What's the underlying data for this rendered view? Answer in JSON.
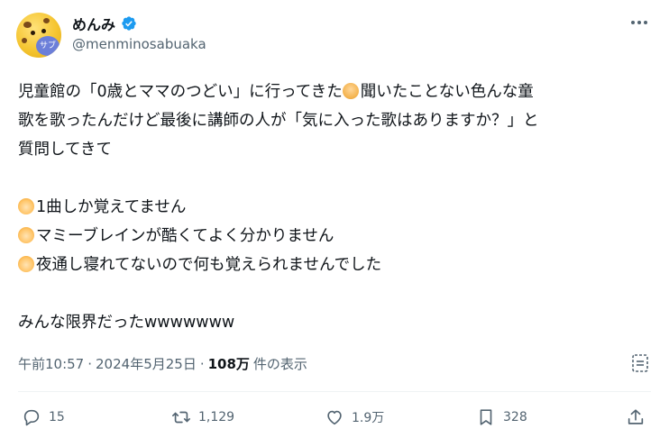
{
  "author": {
    "display_name": "めんみ",
    "handle": "@menminosabuaka",
    "avatar_badge": "サブ"
  },
  "tweet": {
    "lines": [
      "児童館の「0歳とママのつどい」に行ってきた",
      "聞いたことない色んな童",
      "歌を歌ったんだけど最後に講師の人が「気に入った歌はありますか？」と",
      "質問してきて",
      "1曲しか覚えてません",
      "マミーブレインが酷くてよく分かりません",
      "夜通し寝れてないので何も覚えられませんでした",
      "みんな限界だったwwwwwww"
    ]
  },
  "meta": {
    "time": "午前10:57",
    "separator1": "·",
    "date": "2024年5月25日",
    "separator2": "·",
    "views": "108万",
    "views_suffix": "件の表示"
  },
  "actions": {
    "replies": "15",
    "retweets": "1,129",
    "likes": "1.9万",
    "bookmarks": "328"
  },
  "colors": {
    "verified": "#1d9bf0",
    "text": "#0f1419",
    "secondary": "#536471"
  },
  "icons": [
    "verified-badge-icon",
    "more-options-icon",
    "edit-history-icon",
    "reply-icon",
    "retweet-icon",
    "like-icon",
    "bookmark-icon",
    "share-icon"
  ]
}
